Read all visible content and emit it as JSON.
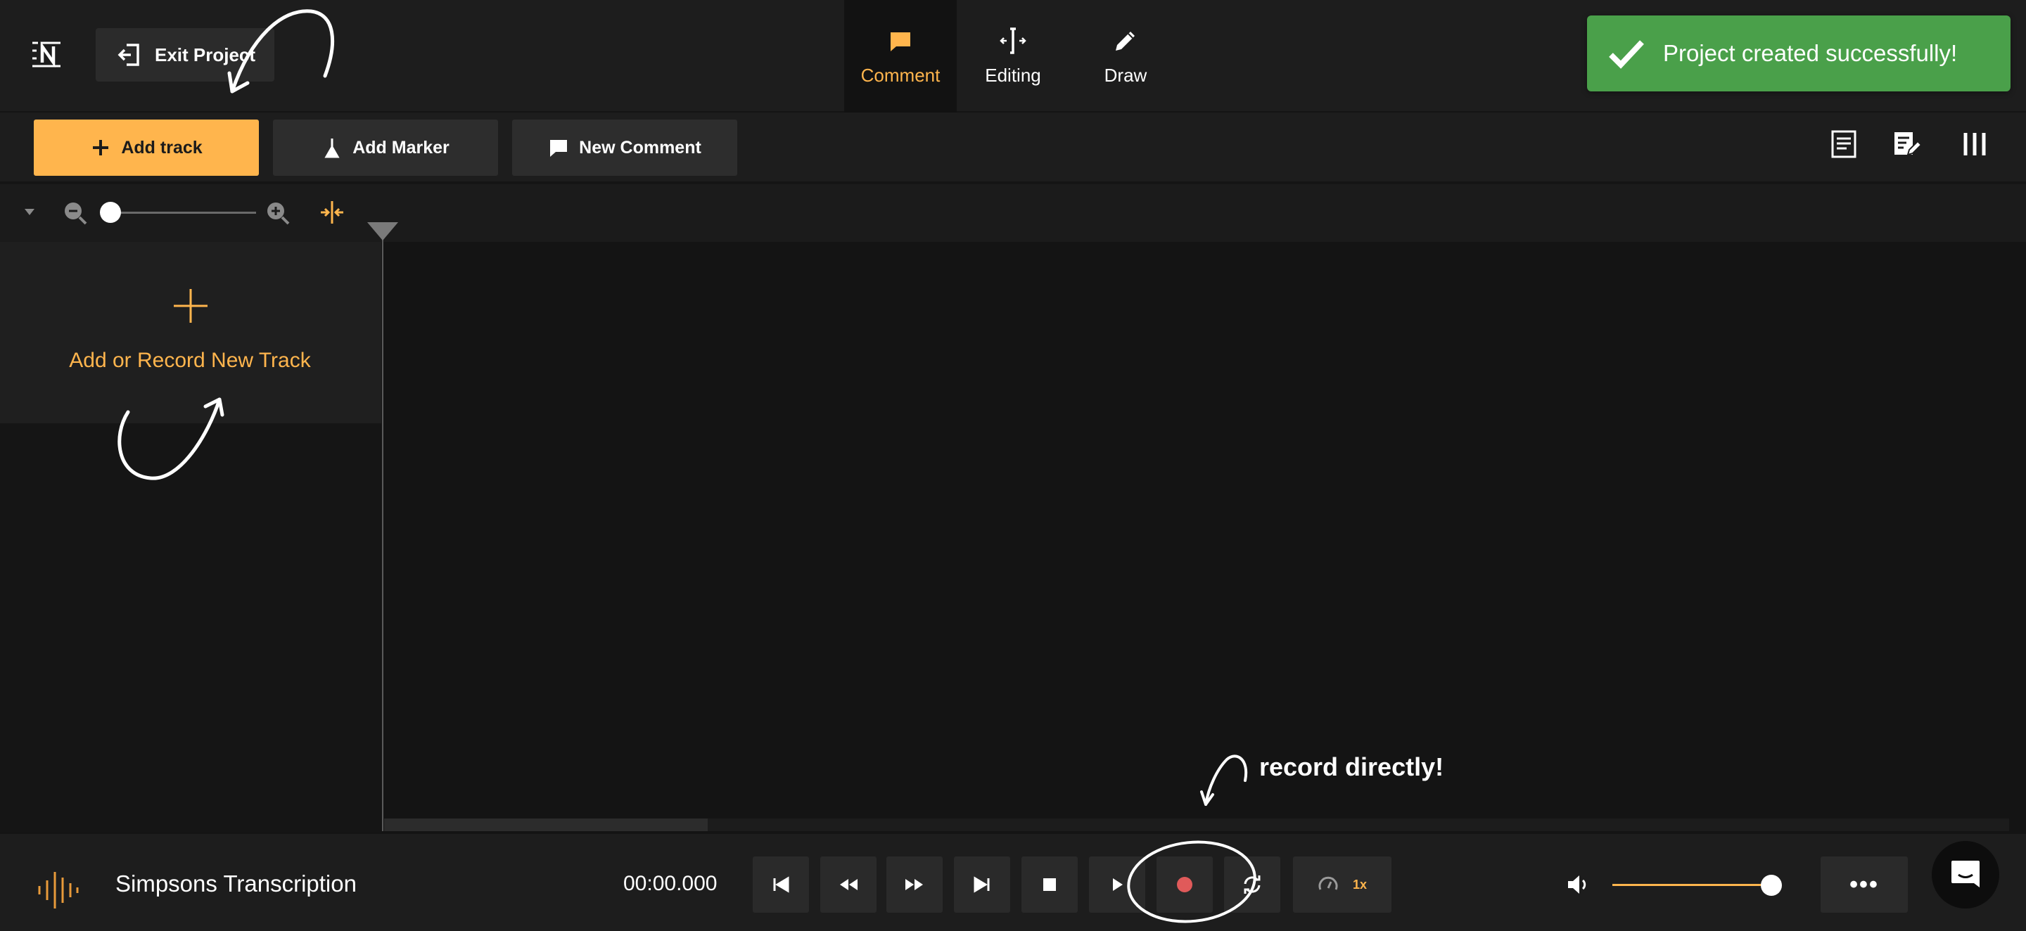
{
  "topbar": {
    "logo_icon": "n-logo-icon",
    "exit_label": "Exit Project",
    "tabs": [
      {
        "label": "Comment",
        "icon": "comment-icon",
        "active": true
      },
      {
        "label": "Editing",
        "icon": "split-icon",
        "active": false
      },
      {
        "label": "Draw",
        "icon": "pencil-icon",
        "active": false
      }
    ]
  },
  "toast": {
    "message": "Project created successfully!",
    "color": "#4aa04a"
  },
  "toolbar": {
    "add_track_label": "Add track",
    "add_marker_label": "Add Marker",
    "new_comment_label": "New Comment",
    "right_icons": [
      "transcript-icon",
      "edit-notes-icon",
      "columns-icon"
    ]
  },
  "zoom": {
    "level": 0.05
  },
  "tracks": {
    "add_label": "Add or Record New Track"
  },
  "annotations": {
    "record_note": "record directly!"
  },
  "transport": {
    "project_name": "Simpsons Transcription",
    "timecode": "00:00.000",
    "speed": "1x",
    "volume": 1.0
  },
  "colors": {
    "accent": "#ffb54d",
    "record": "#e05a5a",
    "success": "#4aa04a"
  }
}
